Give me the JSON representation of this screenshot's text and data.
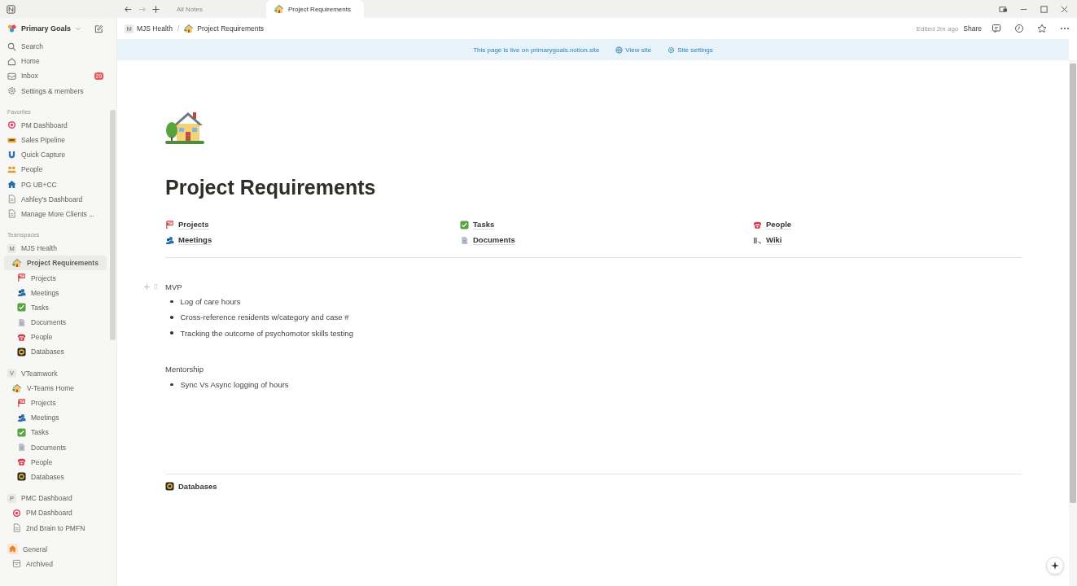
{
  "titlebar": {
    "tabs": [
      {
        "label": "All Notes",
        "selected": false
      },
      {
        "label": "Project Requirements",
        "selected": true,
        "kind": "house"
      }
    ]
  },
  "sidebar": {
    "workspace": "Primary Goals",
    "nav": [
      {
        "label": "Search",
        "kind": "search"
      },
      {
        "label": "Home",
        "kind": "home"
      },
      {
        "label": "Inbox",
        "kind": "inbox",
        "badge": "29"
      },
      {
        "label": "Settings & members",
        "kind": "settings"
      }
    ],
    "favorites": {
      "heading": "Favorites",
      "items": [
        {
          "label": "PM Dashboard",
          "kind": "target",
          "selected": false
        },
        {
          "label": "Sales Pipeline",
          "kind": "tray",
          "selected": false
        },
        {
          "label": "Quick Capture",
          "kind": "magnet",
          "selected": false
        },
        {
          "label": "People",
          "kind": "people",
          "selected": false
        },
        {
          "label": "PG UB+CC",
          "kind": "bluehouse",
          "selected": false
        },
        {
          "label": "Ashley's Dashboard",
          "kind": "page",
          "selected": false
        },
        {
          "label": "Manage More Clients ...",
          "kind": "page",
          "selected": false
        }
      ]
    },
    "teamspaces": {
      "heading": "Teamspaces",
      "spaces": [
        {
          "name": "MJS Health",
          "initial": "M",
          "children": [
            {
              "label": "Project Requirements",
              "kind": "house",
              "selected": true,
              "children": [
                {
                  "label": "Projects",
                  "kind": "projects",
                  "selected": false
                },
                {
                  "label": "Meetings",
                  "kind": "meetings",
                  "selected": false
                },
                {
                  "label": "Tasks",
                  "kind": "tasks",
                  "selected": false
                },
                {
                  "label": "Documents",
                  "kind": "documents",
                  "selected": false
                },
                {
                  "label": "People",
                  "kind": "phone",
                  "selected": false
                },
                {
                  "label": "Databases",
                  "kind": "databases",
                  "selected": false
                }
              ]
            }
          ]
        },
        {
          "name": "VTeamwork",
          "initial": "V",
          "children": [
            {
              "label": "V-Teams Home",
              "kind": "house",
              "selected": false,
              "children": [
                {
                  "label": "Projects",
                  "kind": "projects",
                  "selected": false
                },
                {
                  "label": "Meetings",
                  "kind": "meetings",
                  "selected": false
                },
                {
                  "label": "Tasks",
                  "kind": "tasks",
                  "selected": false
                },
                {
                  "label": "Documents",
                  "kind": "documents",
                  "selected": false
                },
                {
                  "label": "People",
                  "kind": "phone",
                  "selected": false
                },
                {
                  "label": "Databases",
                  "kind": "databases",
                  "selected": false
                }
              ]
            }
          ]
        },
        {
          "name": "PMC Dashboard",
          "initial": "P",
          "children": [
            {
              "label": "PM Dashboard",
              "kind": "target",
              "selected": false
            },
            {
              "label": "2nd Brain to PMFN",
              "kind": "page",
              "selected": false
            }
          ]
        },
        {
          "name": "General",
          "kind": "orangehouse",
          "children": [
            {
              "label": "Archived",
              "kind": "archive",
              "selected": false
            }
          ]
        }
      ]
    }
  },
  "topbar": {
    "breadcrumb_separator": "/",
    "breadcrumb": [
      {
        "label": "MJS Health",
        "initial": "M"
      },
      {
        "label": "Project Requirements",
        "kind": "house"
      }
    ],
    "edited": "Edited 2m ago",
    "share": "Share"
  },
  "banner": {
    "text": "This page is live on primarygoals.notion.site",
    "view_site": "View site",
    "site_settings": "Site settings"
  },
  "page": {
    "title": "Project Requirements",
    "links": [
      {
        "label": "Projects",
        "kind": "projects"
      },
      {
        "label": "Tasks",
        "kind": "tasks"
      },
      {
        "label": "People",
        "kind": "phone"
      },
      {
        "label": "Meetings",
        "kind": "meetings"
      },
      {
        "label": "Documents",
        "kind": "documents"
      },
      {
        "label": "Wiki",
        "kind": "wiki"
      }
    ],
    "sections": [
      {
        "heading": "MVP",
        "hovered": true,
        "bullets": [
          "Log of care hours",
          "Cross-reference residents w/category and case #",
          "Tracking the outcome of psychomotor skills testing"
        ]
      },
      {
        "heading": "Mentorship",
        "hovered": false,
        "bullets": [
          "Sync Vs Async logging of hours"
        ]
      }
    ],
    "footer_link": {
      "label": "Databases",
      "kind": "databases"
    }
  }
}
